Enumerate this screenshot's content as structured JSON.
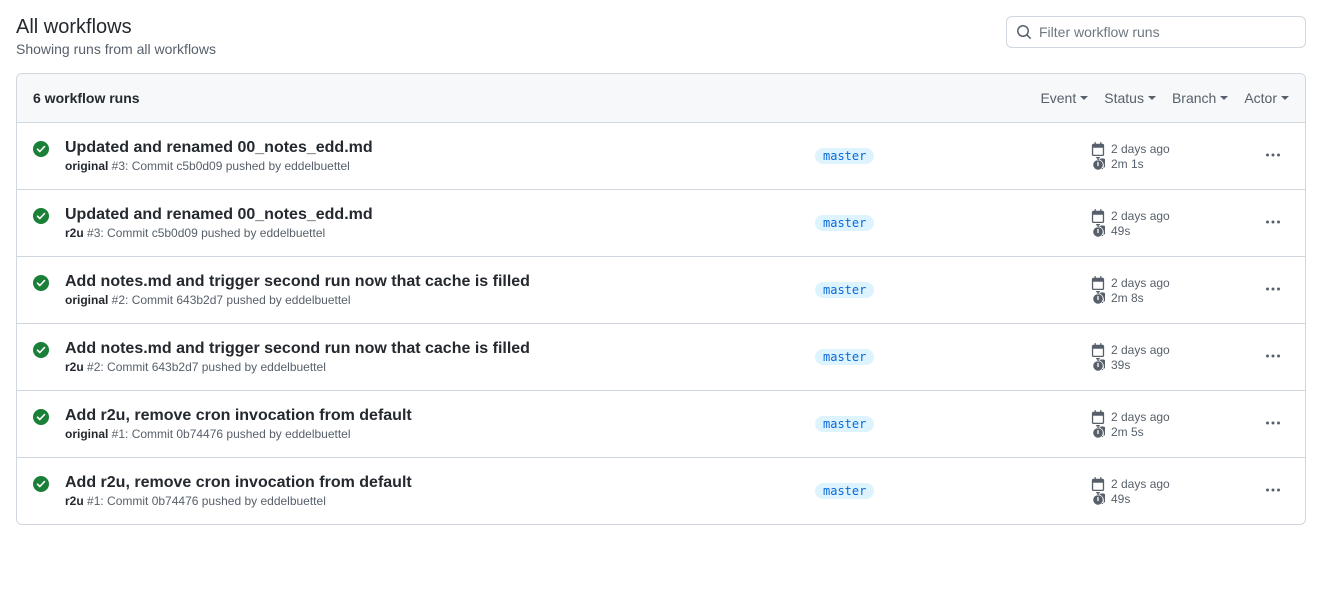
{
  "header": {
    "title": "All workflows",
    "subtitle": "Showing runs from all workflows"
  },
  "search": {
    "placeholder": "Filter workflow runs"
  },
  "box_header": {
    "count_label": "6 workflow runs"
  },
  "filters": {
    "event": "Event",
    "status": "Status",
    "branch": "Branch",
    "actor": "Actor"
  },
  "runs": [
    {
      "title": "Updated and renamed 00_notes_edd.md",
      "workflow": "original",
      "run_meta": " #3: Commit c5b0d09 pushed by eddelbuettel",
      "branch": "master",
      "timestamp": "2 days ago",
      "duration": "2m 1s"
    },
    {
      "title": "Updated and renamed 00_notes_edd.md",
      "workflow": "r2u",
      "run_meta": " #3: Commit c5b0d09 pushed by eddelbuettel",
      "branch": "master",
      "timestamp": "2 days ago",
      "duration": "49s"
    },
    {
      "title": "Add notes.md and trigger second run now that cache is filled",
      "workflow": "original",
      "run_meta": " #2: Commit 643b2d7 pushed by eddelbuettel",
      "branch": "master",
      "timestamp": "2 days ago",
      "duration": "2m 8s"
    },
    {
      "title": "Add notes.md and trigger second run now that cache is filled",
      "workflow": "r2u",
      "run_meta": " #2: Commit 643b2d7 pushed by eddelbuettel",
      "branch": "master",
      "timestamp": "2 days ago",
      "duration": "39s"
    },
    {
      "title": "Add r2u, remove cron invocation from default",
      "workflow": "original",
      "run_meta": " #1: Commit 0b74476 pushed by eddelbuettel",
      "branch": "master",
      "timestamp": "2 days ago",
      "duration": "2m 5s"
    },
    {
      "title": "Add r2u, remove cron invocation from default",
      "workflow": "r2u",
      "run_meta": " #1: Commit 0b74476 pushed by eddelbuettel",
      "branch": "master",
      "timestamp": "2 days ago",
      "duration": "49s"
    }
  ]
}
